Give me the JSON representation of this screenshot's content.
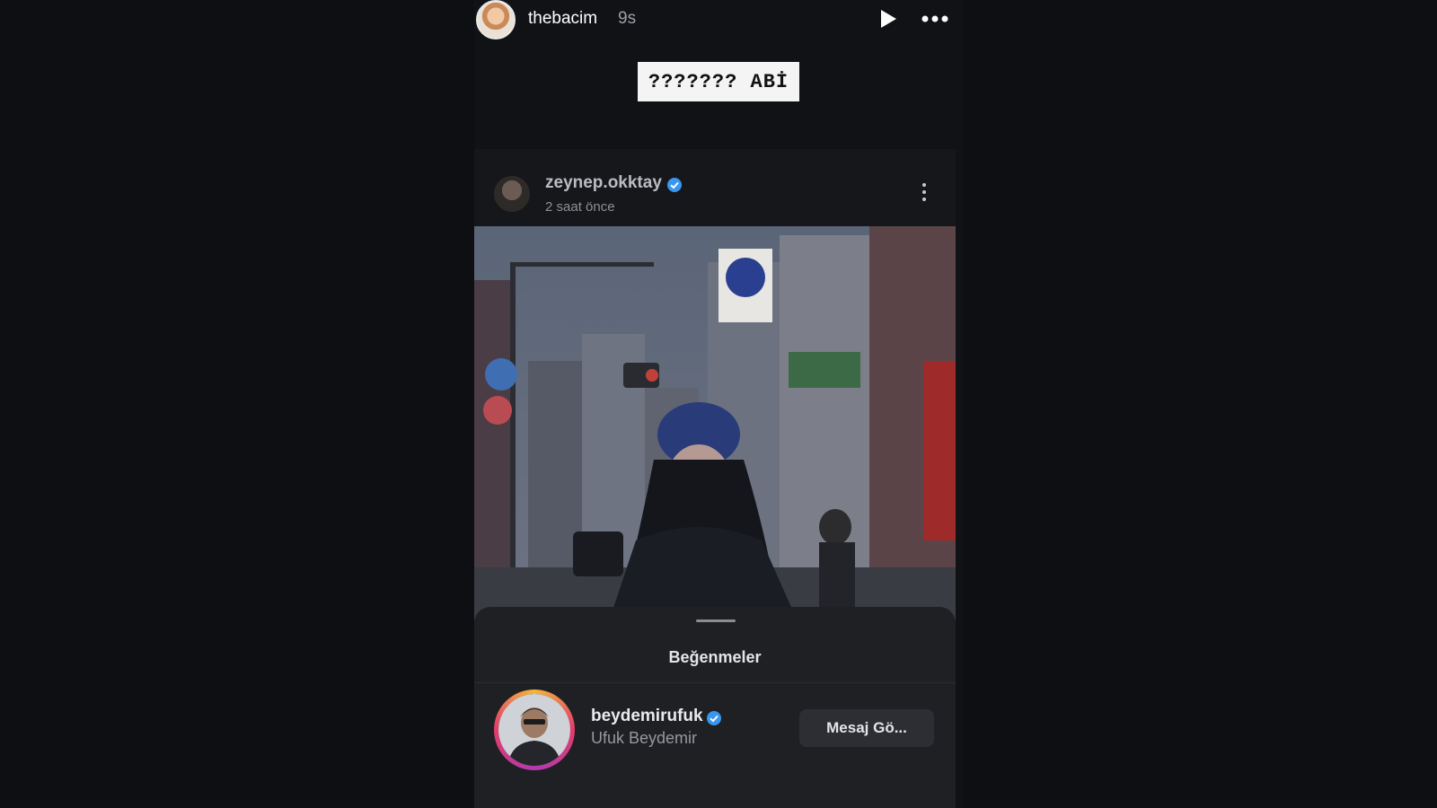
{
  "story": {
    "username": "thebacim",
    "time": "9s",
    "caption": "??????? ABİ"
  },
  "post": {
    "username": "zeynep.okktay",
    "time": "2 saat önce"
  },
  "likes_sheet": {
    "title": "Beğenmeler",
    "items": [
      {
        "username": "beydemirufuk",
        "full_name": "Ufuk Beydemir",
        "button_label": "Mesaj Gö..."
      }
    ]
  },
  "colors": {
    "verified": "#3897f0",
    "background": "#0e0f12"
  }
}
